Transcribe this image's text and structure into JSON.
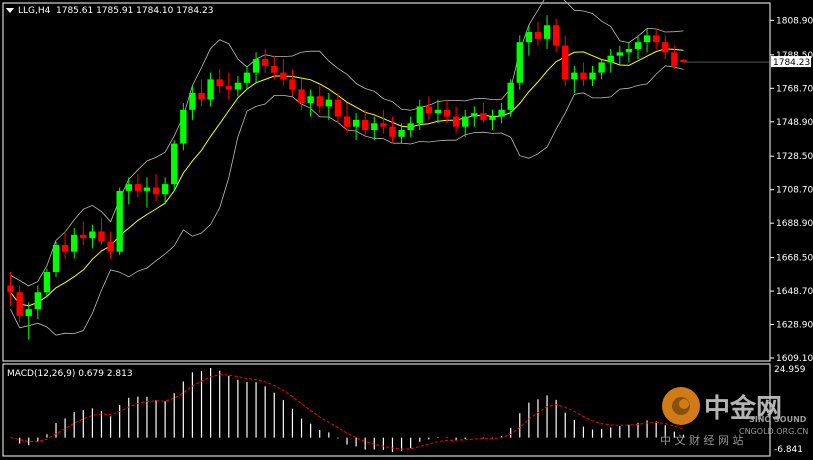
{
  "header": {
    "symbol_timeframe": "LLG,H4",
    "ohlc": "1785.61 1785.91 1784.10 1784.23"
  },
  "macd_panel": {
    "label": "MACD(12,26,9) 0.679 2.813",
    "scale_top": "24.959",
    "scale_bottom": "-6.841"
  },
  "current_price": "1784.23",
  "watermark": {
    "brand_cn": "中金网",
    "subtitle_cn": "中 文 财 经 网 站",
    "subtitle_en": "CNGOLD.ORG.CN",
    "logo_text": "SINO SOUND"
  },
  "colors": {
    "background": "#000000",
    "bull": "#00ff00",
    "bear": "#ff0000",
    "bollinger": "#bbbbbb",
    "ma": "#ffff00",
    "macd_hist": "#ffffff",
    "macd_signal": "#ff0000",
    "axis": "#ffffff"
  },
  "chart_data": {
    "type": "candlestick",
    "price_axis": {
      "ticks": [
        "1808.90",
        "1788.50",
        "1768.70",
        "1748.90",
        "1728.50",
        "1708.70",
        "1688.90",
        "1668.50",
        "1648.70",
        "1628.90",
        "1609.10"
      ],
      "ylim": [
        1609.1,
        1818.0
      ]
    },
    "candles": [
      [
        1652,
        1660,
        1640,
        1648
      ],
      [
        1648,
        1652,
        1630,
        1634
      ],
      [
        1634,
        1642,
        1620,
        1638
      ],
      [
        1638,
        1652,
        1632,
        1648
      ],
      [
        1648,
        1662,
        1645,
        1660
      ],
      [
        1660,
        1678,
        1657,
        1676
      ],
      [
        1676,
        1684,
        1668,
        1672
      ],
      [
        1672,
        1686,
        1668,
        1682
      ],
      [
        1682,
        1690,
        1676,
        1680
      ],
      [
        1680,
        1688,
        1674,
        1684
      ],
      [
        1684,
        1692,
        1676,
        1678
      ],
      [
        1678,
        1684,
        1668,
        1672
      ],
      [
        1672,
        1710,
        1670,
        1708
      ],
      [
        1708,
        1716,
        1700,
        1712
      ],
      [
        1712,
        1718,
        1704,
        1708
      ],
      [
        1708,
        1716,
        1698,
        1710
      ],
      [
        1710,
        1718,
        1702,
        1706
      ],
      [
        1706,
        1716,
        1700,
        1712
      ],
      [
        1712,
        1738,
        1708,
        1736
      ],
      [
        1736,
        1760,
        1732,
        1756
      ],
      [
        1756,
        1770,
        1750,
        1766
      ],
      [
        1766,
        1774,
        1758,
        1762
      ],
      [
        1762,
        1778,
        1758,
        1774
      ],
      [
        1774,
        1780,
        1766,
        1770
      ],
      [
        1770,
        1778,
        1762,
        1768
      ],
      [
        1768,
        1776,
        1764,
        1772
      ],
      [
        1772,
        1782,
        1768,
        1778
      ],
      [
        1778,
        1790,
        1772,
        1786
      ],
      [
        1786,
        1792,
        1778,
        1782
      ],
      [
        1782,
        1788,
        1774,
        1778
      ],
      [
        1778,
        1786,
        1770,
        1774
      ],
      [
        1774,
        1780,
        1764,
        1768
      ],
      [
        1768,
        1774,
        1756,
        1760
      ],
      [
        1760,
        1768,
        1752,
        1764
      ],
      [
        1764,
        1770,
        1754,
        1758
      ],
      [
        1758,
        1766,
        1750,
        1762
      ],
      [
        1762,
        1766,
        1748,
        1752
      ],
      [
        1752,
        1760,
        1742,
        1746
      ],
      [
        1746,
        1754,
        1738,
        1750
      ],
      [
        1750,
        1756,
        1740,
        1744
      ],
      [
        1744,
        1752,
        1738,
        1748
      ],
      [
        1748,
        1756,
        1742,
        1746
      ],
      [
        1746,
        1752,
        1736,
        1740
      ],
      [
        1740,
        1748,
        1736,
        1744
      ],
      [
        1744,
        1752,
        1740,
        1748
      ],
      [
        1748,
        1762,
        1744,
        1758
      ],
      [
        1758,
        1764,
        1750,
        1754
      ],
      [
        1754,
        1762,
        1748,
        1756
      ],
      [
        1756,
        1762,
        1748,
        1752
      ],
      [
        1752,
        1758,
        1742,
        1746
      ],
      [
        1746,
        1756,
        1740,
        1752
      ],
      [
        1752,
        1758,
        1746,
        1754
      ],
      [
        1754,
        1760,
        1748,
        1750
      ],
      [
        1750,
        1756,
        1744,
        1752
      ],
      [
        1752,
        1760,
        1748,
        1756
      ],
      [
        1756,
        1774,
        1752,
        1772
      ],
      [
        1772,
        1800,
        1768,
        1796
      ],
      [
        1796,
        1806,
        1788,
        1802
      ],
      [
        1802,
        1808,
        1794,
        1798
      ],
      [
        1798,
        1812,
        1792,
        1806
      ],
      [
        1806,
        1810,
        1790,
        1794
      ],
      [
        1794,
        1800,
        1770,
        1774
      ],
      [
        1774,
        1782,
        1766,
        1778
      ],
      [
        1778,
        1784,
        1770,
        1774
      ],
      [
        1774,
        1782,
        1770,
        1778
      ],
      [
        1778,
        1786,
        1774,
        1784
      ],
      [
        1784,
        1792,
        1778,
        1788
      ],
      [
        1788,
        1794,
        1782,
        1790
      ],
      [
        1790,
        1796,
        1784,
        1792
      ],
      [
        1792,
        1800,
        1786,
        1796
      ],
      [
        1796,
        1804,
        1790,
        1800
      ],
      [
        1800,
        1804,
        1792,
        1796
      ],
      [
        1796,
        1800,
        1786,
        1790
      ],
      [
        1790,
        1794,
        1780,
        1782
      ],
      [
        1785.61,
        1785.91,
        1784.1,
        1784.23
      ]
    ],
    "candle_format": [
      "open",
      "high",
      "low",
      "close"
    ]
  }
}
